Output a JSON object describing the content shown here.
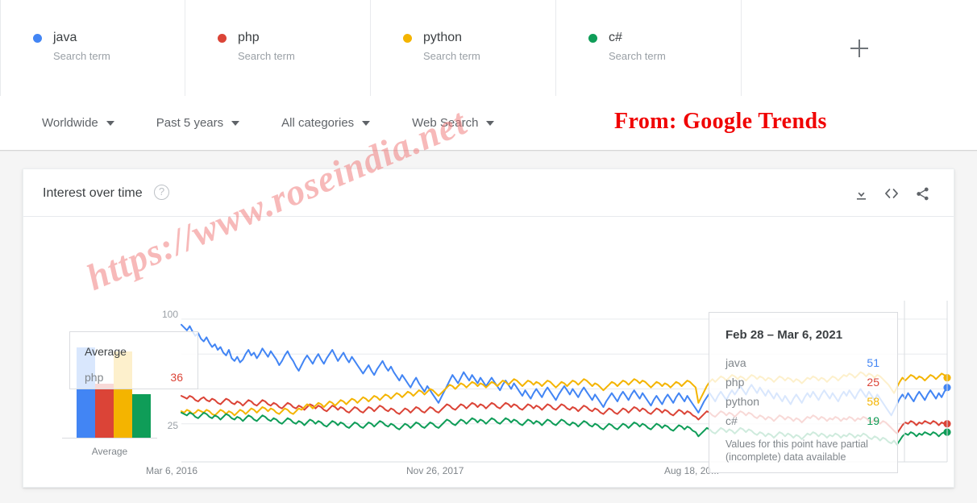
{
  "terms": [
    {
      "label": "java",
      "sub": "Search term",
      "color": "#4285F4"
    },
    {
      "label": "php",
      "sub": "Search term",
      "color": "#DB4437"
    },
    {
      "label": "python",
      "sub": "Search term",
      "color": "#F4B400"
    },
    {
      "label": "c#",
      "sub": "Search term",
      "color": "#0F9D58"
    }
  ],
  "add_button_label": "+",
  "filters": [
    {
      "label": "Worldwide"
    },
    {
      "label": "Past 5 years"
    },
    {
      "label": "All categories"
    },
    {
      "label": "Web Search"
    }
  ],
  "annotation": {
    "text": "From: Google Trends",
    "color": "#f00000"
  },
  "watermark": {
    "text": "https://www.roseindia.net",
    "color": "#f07878"
  },
  "card": {
    "title": "Interest over time",
    "help_icon_label": "?",
    "actions": [
      {
        "name": "download-icon"
      },
      {
        "name": "embed-code-icon"
      },
      {
        "name": "share-icon"
      }
    ]
  },
  "average_tooltip": {
    "title": "Average",
    "term": "php",
    "value": "36",
    "value_color": "#DB4437"
  },
  "point_tooltip": {
    "title": "Feb 28 – Mar 6, 2021",
    "rows": [
      {
        "name": "java",
        "value": "51",
        "color": "#4285F4"
      },
      {
        "name": "php",
        "value": "25",
        "color": "#DB4437"
      },
      {
        "name": "python",
        "value": "58",
        "color": "#F4B400"
      },
      {
        "name": "c#",
        "value": "19",
        "color": "#0F9D58"
      }
    ],
    "note": "Values for this point have partial (incomplete) data available"
  },
  "chart_data": {
    "type": "line",
    "title": "Interest over time",
    "xlabel": "",
    "ylabel": "",
    "ylim": [
      0,
      104
    ],
    "yticks": [
      25,
      50,
      75,
      100
    ],
    "ytick_labels": [
      "25",
      "",
      "",
      "100"
    ],
    "grid": true,
    "legend": "top",
    "xtick_labels": [
      "Mar 6, 2016",
      "Nov 26, 2017",
      "Aug 18, 20..."
    ],
    "xtick_positions": [
      0.0,
      0.5,
      1.0
    ],
    "average_bar_chart": {
      "type": "bar",
      "categories": [
        "java",
        "php",
        "python",
        "c#"
      ],
      "values": [
        60,
        36,
        57,
        29
      ],
      "colors": [
        "#4285F4",
        "#DB4437",
        "#F4B400",
        "#0F9D58"
      ],
      "xlabel": "Average"
    },
    "series": [
      {
        "name": "java",
        "color": "#4285F4",
        "end_value": 51,
        "values": [
          96,
          94,
          92,
          95,
          91,
          88,
          90,
          86,
          84,
          87,
          83,
          80,
          82,
          78,
          80,
          76,
          74,
          78,
          72,
          70,
          73,
          69,
          71,
          75,
          78,
          74,
          76,
          72,
          75,
          79,
          76,
          73,
          77,
          74,
          71,
          67,
          70,
          74,
          77,
          73,
          70,
          66,
          63,
          67,
          71,
          74,
          71,
          68,
          72,
          75,
          71,
          68,
          72,
          75,
          78,
          74,
          70,
          73,
          76,
          72,
          69,
          73,
          70,
          67,
          64,
          61,
          64,
          67,
          63,
          60,
          64,
          67,
          70,
          66,
          63,
          66,
          62,
          59,
          56,
          60,
          57,
          54,
          51,
          55,
          58,
          54,
          51,
          48,
          52,
          49,
          46,
          43,
          40,
          44,
          48,
          52,
          56,
          60,
          57,
          54,
          58,
          62,
          59,
          56,
          60,
          57,
          54,
          58,
          55,
          52,
          55,
          58,
          55,
          52,
          49,
          53,
          56,
          53,
          50,
          54,
          51,
          48,
          45,
          49,
          46,
          43,
          47,
          50,
          47,
          44,
          48,
          51,
          48,
          45,
          42,
          46,
          49,
          52,
          49,
          46,
          50,
          47,
          44,
          48,
          51,
          48,
          45,
          42,
          46,
          43,
          40,
          37,
          41,
          44,
          47,
          44,
          41,
          45,
          48,
          45,
          42,
          46,
          49,
          46,
          43,
          47,
          44,
          41,
          38,
          42,
          45,
          42,
          39,
          43,
          46,
          43,
          40,
          44,
          47,
          44,
          41,
          45,
          42,
          39,
          36,
          33,
          37,
          41,
          44,
          47,
          44,
          41,
          45,
          48,
          45,
          42,
          46,
          49,
          46,
          49,
          52,
          49,
          46,
          50,
          53,
          50,
          47,
          51,
          48,
          45,
          49,
          46,
          43,
          47,
          44,
          41,
          45,
          42,
          39,
          43,
          46,
          43,
          40,
          44,
          47,
          44,
          48,
          45,
          42,
          46,
          49,
          46,
          43,
          47,
          44,
          41,
          45,
          48,
          45,
          49,
          46,
          43,
          47,
          50,
          47,
          44,
          48,
          45,
          42,
          46,
          43,
          40,
          37,
          34,
          31,
          35,
          39,
          43,
          46,
          43,
          47,
          44,
          41,
          45,
          48,
          45,
          42,
          46,
          49,
          46,
          43,
          47,
          44,
          48,
          51
        ]
      },
      {
        "name": "php",
        "color": "#DB4437",
        "end_value": 25,
        "values": [
          45,
          44,
          43,
          45,
          44,
          42,
          41,
          43,
          44,
          42,
          41,
          43,
          42,
          40,
          39,
          41,
          43,
          42,
          40,
          39,
          41,
          40,
          38,
          40,
          42,
          41,
          39,
          38,
          40,
          42,
          41,
          39,
          38,
          40,
          39,
          37,
          36,
          38,
          40,
          39,
          37,
          36,
          38,
          37,
          35,
          37,
          39,
          38,
          36,
          38,
          37,
          35,
          34,
          36,
          38,
          37,
          35,
          37,
          36,
          34,
          33,
          35,
          37,
          36,
          34,
          33,
          35,
          37,
          36,
          34,
          36,
          38,
          37,
          35,
          34,
          36,
          35,
          33,
          32,
          34,
          36,
          35,
          33,
          35,
          37,
          36,
          34,
          33,
          35,
          37,
          36,
          34,
          33,
          35,
          37,
          39,
          38,
          36,
          35,
          37,
          39,
          38,
          36,
          38,
          40,
          39,
          37,
          39,
          38,
          36,
          38,
          40,
          39,
          37,
          36,
          38,
          40,
          39,
          37,
          39,
          38,
          36,
          35,
          37,
          39,
          38,
          36,
          38,
          37,
          35,
          37,
          39,
          38,
          36,
          35,
          37,
          39,
          38,
          36,
          35,
          37,
          36,
          34,
          36,
          38,
          37,
          35,
          34,
          36,
          35,
          33,
          32,
          34,
          36,
          35,
          33,
          32,
          34,
          36,
          35,
          33,
          35,
          37,
          36,
          34,
          36,
          35,
          33,
          32,
          34,
          36,
          35,
          33,
          35,
          34,
          32,
          31,
          33,
          35,
          34,
          32,
          34,
          33,
          31,
          30,
          28,
          30,
          32,
          34,
          33,
          31,
          30,
          32,
          34,
          33,
          31,
          33,
          32,
          30,
          32,
          34,
          33,
          31,
          33,
          32,
          30,
          29,
          31,
          30,
          28,
          30,
          29,
          27,
          29,
          31,
          30,
          28,
          30,
          29,
          27,
          29,
          28,
          26,
          28,
          30,
          29,
          31,
          30,
          28,
          30,
          29,
          27,
          29,
          28,
          30,
          29,
          27,
          29,
          28,
          30,
          29,
          27,
          29,
          28,
          30,
          29,
          27,
          26,
          28,
          27,
          25,
          27,
          26,
          24,
          22,
          20,
          18,
          21,
          24,
          26,
          25,
          27,
          26,
          24,
          26,
          25,
          27,
          26,
          25,
          27,
          26,
          24,
          26,
          25,
          25
        ]
      },
      {
        "name": "python",
        "color": "#F4B400",
        "end_value": 58,
        "values": [
          34,
          33,
          35,
          34,
          32,
          33,
          35,
          34,
          33,
          35,
          34,
          32,
          31,
          33,
          35,
          34,
          32,
          34,
          33,
          31,
          33,
          35,
          34,
          32,
          34,
          36,
          35,
          33,
          35,
          37,
          36,
          34,
          36,
          35,
          33,
          32,
          34,
          36,
          35,
          33,
          32,
          34,
          36,
          35,
          37,
          39,
          38,
          36,
          38,
          40,
          39,
          37,
          39,
          41,
          40,
          38,
          40,
          42,
          41,
          39,
          41,
          43,
          42,
          40,
          42,
          44,
          43,
          41,
          43,
          45,
          44,
          42,
          44,
          46,
          45,
          43,
          45,
          47,
          46,
          44,
          46,
          48,
          47,
          45,
          47,
          49,
          48,
          46,
          48,
          50,
          49,
          47,
          45,
          47,
          49,
          51,
          53,
          52,
          50,
          52,
          54,
          53,
          51,
          53,
          55,
          54,
          52,
          54,
          53,
          51,
          53,
          55,
          54,
          52,
          54,
          56,
          55,
          53,
          55,
          57,
          56,
          54,
          52,
          54,
          56,
          55,
          53,
          55,
          54,
          52,
          54,
          56,
          55,
          53,
          51,
          53,
          55,
          54,
          52,
          54,
          56,
          55,
          53,
          55,
          57,
          56,
          54,
          52,
          54,
          53,
          51,
          49,
          51,
          53,
          55,
          54,
          52,
          54,
          56,
          55,
          53,
          55,
          57,
          56,
          54,
          56,
          55,
          53,
          51,
          53,
          55,
          54,
          52,
          54,
          53,
          51,
          53,
          55,
          54,
          52,
          54,
          56,
          55,
          53,
          51,
          40,
          44,
          48,
          52,
          55,
          57,
          55,
          57,
          59,
          58,
          56,
          58,
          60,
          59,
          57,
          59,
          58,
          56,
          58,
          60,
          59,
          57,
          59,
          58,
          56,
          58,
          57,
          55,
          57,
          59,
          58,
          56,
          58,
          57,
          55,
          57,
          56,
          54,
          56,
          58,
          57,
          59,
          58,
          56,
          58,
          57,
          55,
          57,
          59,
          58,
          56,
          58,
          60,
          59,
          61,
          60,
          58,
          60,
          62,
          61,
          59,
          61,
          60,
          58,
          60,
          59,
          57,
          55,
          53,
          50,
          47,
          51,
          55,
          58,
          56,
          58,
          60,
          59,
          57,
          59,
          58,
          56,
          58,
          60,
          59,
          57,
          59,
          61,
          60,
          58
        ]
      },
      {
        "name": "c#",
        "color": "#0F9D58",
        "end_value": 19,
        "values": [
          33,
          32,
          31,
          33,
          32,
          30,
          29,
          31,
          33,
          32,
          30,
          29,
          31,
          30,
          28,
          30,
          32,
          31,
          29,
          28,
          30,
          29,
          27,
          29,
          31,
          30,
          28,
          27,
          29,
          31,
          30,
          28,
          27,
          29,
          28,
          26,
          25,
          27,
          29,
          28,
          26,
          25,
          27,
          26,
          24,
          26,
          28,
          27,
          25,
          27,
          26,
          24,
          23,
          25,
          27,
          26,
          24,
          26,
          25,
          23,
          22,
          24,
          26,
          25,
          23,
          22,
          24,
          26,
          25,
          23,
          25,
          27,
          26,
          24,
          23,
          25,
          24,
          22,
          21,
          23,
          25,
          24,
          22,
          24,
          26,
          25,
          23,
          22,
          24,
          26,
          25,
          23,
          22,
          24,
          26,
          28,
          27,
          25,
          24,
          26,
          28,
          27,
          25,
          27,
          29,
          28,
          26,
          28,
          27,
          25,
          27,
          29,
          28,
          26,
          25,
          27,
          29,
          28,
          26,
          28,
          27,
          25,
          24,
          26,
          28,
          27,
          25,
          27,
          26,
          24,
          26,
          28,
          27,
          25,
          24,
          26,
          28,
          27,
          25,
          24,
          26,
          25,
          23,
          25,
          27,
          26,
          24,
          23,
          25,
          24,
          22,
          21,
          23,
          25,
          24,
          22,
          21,
          23,
          25,
          24,
          22,
          24,
          26,
          25,
          23,
          25,
          24,
          22,
          21,
          23,
          25,
          24,
          22,
          24,
          23,
          21,
          20,
          22,
          24,
          23,
          21,
          23,
          22,
          20,
          19,
          16,
          18,
          20,
          22,
          21,
          19,
          18,
          20,
          22,
          21,
          19,
          21,
          20,
          18,
          20,
          22,
          21,
          19,
          21,
          20,
          18,
          17,
          19,
          18,
          16,
          18,
          17,
          15,
          17,
          19,
          18,
          16,
          18,
          17,
          15,
          17,
          16,
          14,
          16,
          18,
          17,
          19,
          18,
          16,
          18,
          17,
          15,
          17,
          16,
          18,
          17,
          15,
          17,
          16,
          18,
          17,
          15,
          17,
          16,
          18,
          17,
          15,
          14,
          16,
          15,
          13,
          15,
          14,
          12,
          11,
          13,
          10,
          13,
          16,
          18,
          17,
          19,
          18,
          16,
          18,
          17,
          19,
          18,
          17,
          19,
          18,
          16,
          18,
          19,
          19
        ]
      }
    ]
  }
}
